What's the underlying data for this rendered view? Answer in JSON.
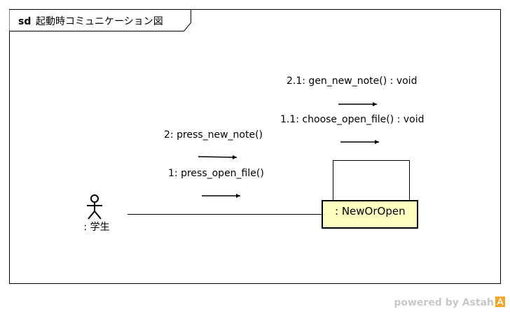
{
  "frame": {
    "keyword": "sd",
    "title": "起動時コミュニケーション図"
  },
  "actor": {
    "label": ": 学生"
  },
  "object": {
    "label": ": NewOrOpen",
    "fill": "#ffffc0",
    "border": "#000000"
  },
  "messages": [
    {
      "label": "1: press_open_file()"
    },
    {
      "label": "2: press_new_note()"
    },
    {
      "label": "1.1: choose_open_file() : void"
    },
    {
      "label": "2.1: gen_new_note() : void"
    }
  ],
  "watermark": {
    "text": "powered by Astah",
    "color": "#c8c8c8",
    "logo_color": "#f5a623"
  }
}
